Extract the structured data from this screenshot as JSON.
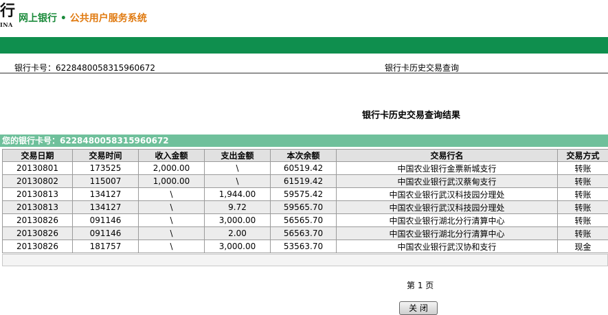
{
  "header": {
    "logo_char": "行",
    "logo_sub": "INA",
    "brand_part1": "网上银行",
    "brand_dot": "•",
    "brand_part2": "公共用户服务系统"
  },
  "infobar": {
    "card_label": "银行卡号：6228480058315960672",
    "page_name": "银行卡历史交易查询"
  },
  "result_title": "银行卡历史交易查询结果",
  "account_bar": "您的银行卡号：6228480058315960672",
  "table": {
    "headers": [
      "交易日期",
      "交易时间",
      "收入金额",
      "支出金额",
      "本次余额",
      "交易行名",
      "交易方式"
    ],
    "rows": [
      [
        "20130801",
        "173525",
        "2,000.00",
        "\\",
        "60519.42",
        "中国农业银行金票新城支行",
        "转账"
      ],
      [
        "20130802",
        "115007",
        "1,000.00",
        "\\",
        "61519.42",
        "中国农业银行武汉蔡甸支行",
        "转账"
      ],
      [
        "20130813",
        "134127",
        "\\",
        "1,944.00",
        "59575.42",
        "中国农业银行武汉科技园分理处",
        "转账"
      ],
      [
        "20130813",
        "134127",
        "\\",
        "9.72",
        "59565.70",
        "中国农业银行武汉科技园分理处",
        "转账"
      ],
      [
        "20130826",
        "091146",
        "\\",
        "3,000.00",
        "56565.70",
        "中国农业银行湖北分行清算中心",
        "转账"
      ],
      [
        "20130826",
        "091146",
        "\\",
        "2.00",
        "56563.70",
        "中国农业银行湖北分行清算中心",
        "转账"
      ],
      [
        "20130826",
        "181757",
        "\\",
        "3,000.00",
        "53563.70",
        "中国农业银行武汉协和支行",
        "现金"
      ]
    ]
  },
  "pagination": "第  1 页",
  "close_button": "关 闭",
  "colors": {
    "green_bar": "#0f8f4e",
    "account_bar": "#6fc09b",
    "brand_green": "#1a8a3a",
    "brand_orange": "#e07a10"
  }
}
